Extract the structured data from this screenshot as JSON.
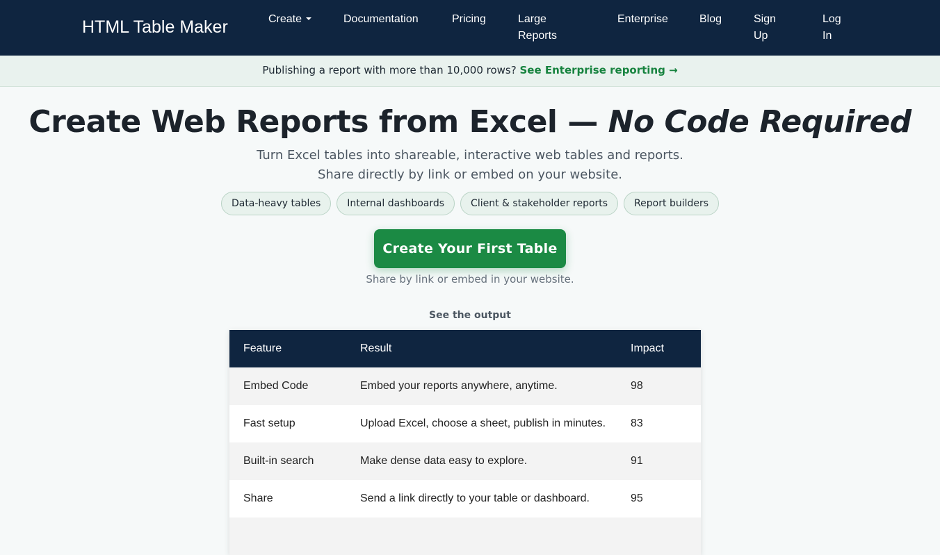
{
  "navbar": {
    "brand": "HTML Table Maker",
    "items": [
      {
        "label": "Create",
        "dropdown": true
      },
      {
        "label": "Documentation"
      },
      {
        "label": "Pricing"
      },
      {
        "label": "Large Reports"
      },
      {
        "label": "Enterprise"
      },
      {
        "label": "Blog"
      },
      {
        "label": "Sign Up"
      },
      {
        "label": "Log In"
      }
    ]
  },
  "banner": {
    "text": "Publishing a report with more than 10,000 rows?",
    "link": "See Enterprise reporting →"
  },
  "hero": {
    "title_main": "Create Web Reports from Excel — ",
    "title_emphasis": "No Code Required",
    "subtitle": "Turn Excel tables into shareable, interactive web tables and reports. Share directly by link or embed on your website.",
    "chips": [
      "Data-heavy tables",
      "Internal dashboards",
      "Client & stakeholder reports",
      "Report builders"
    ],
    "cta_label": "Create Your First Table",
    "cta_note": "Share by link or embed in your website."
  },
  "output": {
    "label": "See the output",
    "columns": [
      "Feature",
      "Result",
      "Impact"
    ],
    "rows": [
      [
        "Embed Code",
        "Embed your reports anywhere, anytime.",
        "98"
      ],
      [
        "Fast setup",
        "Upload Excel, choose a sheet, publish in minutes.",
        "83"
      ],
      [
        "Built-in search",
        "Make dense data easy to explore.",
        "91"
      ],
      [
        "Share",
        "Send a link directly to your table or dashboard.",
        "95"
      ],
      [
        "",
        "",
        ""
      ]
    ]
  },
  "colors": {
    "navbar_bg": "#0f2540",
    "accent_green": "#1b8a44",
    "banner_bg": "#e9f2ee"
  }
}
